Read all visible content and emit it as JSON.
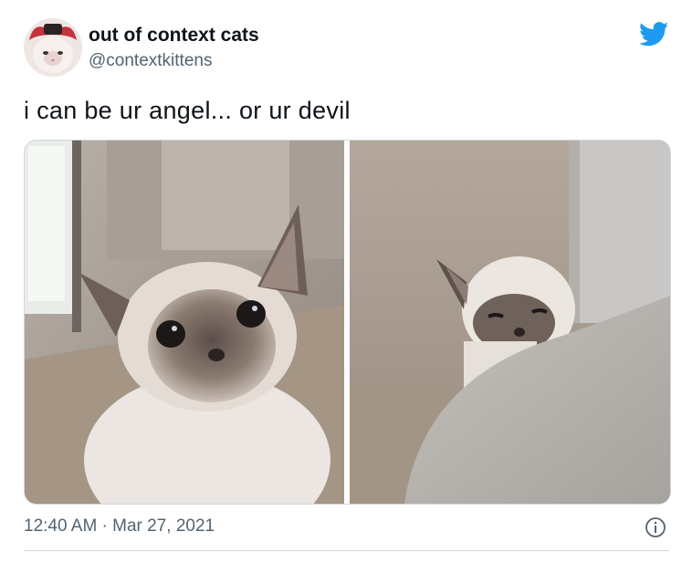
{
  "author": {
    "display_name": "out of context cats",
    "handle": "@contextkittens",
    "avatar_icon": "cat-avatar"
  },
  "brand": {
    "icon": "twitter-bird-icon",
    "color": "#1d9bf0"
  },
  "tweet": {
    "text": "i can be ur angel... or ur devil"
  },
  "media": {
    "photos": [
      {
        "subject": "cat-looking-up-photo"
      },
      {
        "subject": "cat-peeking-photo"
      }
    ]
  },
  "meta": {
    "timestamp": "12:40 AM · Mar 27, 2021",
    "info_icon": "info-icon"
  },
  "colors": {
    "text": "#0f1419",
    "secondary_text": "#536471",
    "border": "#cfd9de"
  }
}
